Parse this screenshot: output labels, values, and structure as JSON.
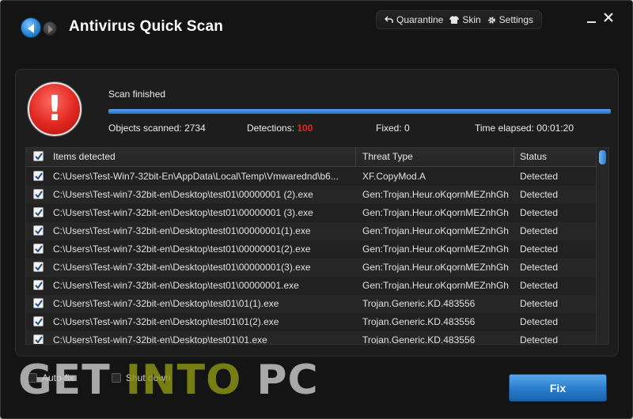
{
  "window": {
    "title": "Antivirus Quick Scan",
    "menu": [
      {
        "label": "Quarantine",
        "icon": "back-arrow-icon"
      },
      {
        "label": "Skin",
        "icon": "shirt-icon"
      },
      {
        "label": "Settings",
        "icon": "gear-icon"
      }
    ]
  },
  "scan": {
    "status": "Scan finished",
    "progress_percent": 100,
    "objects_label": "Objects scanned:",
    "objects_value": "2734",
    "detections_label": "Detections:",
    "detections_value": "100",
    "fixed_label": "Fixed:",
    "fixed_value": "0",
    "elapsed_label": "Time elapsed:",
    "elapsed_value": "00:01:20"
  },
  "table": {
    "headers": {
      "items": "Items detected",
      "threat": "Threat Type",
      "status": "Status"
    },
    "rows": [
      {
        "path": "C:\\Users\\Test-Win7-32bit-En\\AppData\\Local\\Temp\\Vmwarednd\\b6...",
        "threat": "XF.CopyMod.A",
        "status": "Detected"
      },
      {
        "path": "C:\\Users\\Test-win7-32bit-en\\Desktop\\test01\\00000001 (2).exe",
        "threat": "Gen:Trojan.Heur.oKqornMEZnhGh",
        "status": "Detected"
      },
      {
        "path": "C:\\Users\\Test-win7-32bit-en\\Desktop\\test01\\00000001 (3).exe",
        "threat": "Gen:Trojan.Heur.oKqornMEZnhGh",
        "status": "Detected"
      },
      {
        "path": "C:\\Users\\Test-win7-32bit-en\\Desktop\\test01\\00000001(1).exe",
        "threat": "Gen:Trojan.Heur.oKqornMEZnhGh",
        "status": "Detected"
      },
      {
        "path": "C:\\Users\\Test-win7-32bit-en\\Desktop\\test01\\00000001(2).exe",
        "threat": "Gen:Trojan.Heur.oKqornMEZnhGh",
        "status": "Detected"
      },
      {
        "path": "C:\\Users\\Test-win7-32bit-en\\Desktop\\test01\\00000001(3).exe",
        "threat": "Gen:Trojan.Heur.oKqornMEZnhGh",
        "status": "Detected"
      },
      {
        "path": "C:\\Users\\Test-win7-32bit-en\\Desktop\\test01\\00000001.exe",
        "threat": "Gen:Trojan.Heur.oKqornMEZnhGh",
        "status": "Detected"
      },
      {
        "path": "C:\\Users\\Test-win7-32bit-en\\Desktop\\test01\\01(1).exe",
        "threat": "Trojan.Generic.KD.483556",
        "status": "Detected"
      },
      {
        "path": "C:\\Users\\Test-win7-32bit-en\\Desktop\\test01\\01(2).exe",
        "threat": "Trojan.Generic.KD.483556",
        "status": "Detected"
      },
      {
        "path": "C:\\Users\\Test-win7-32bit-en\\Desktop\\test01\\01.exe",
        "threat": "Trojan.Generic.KD.483556",
        "status": "Detected"
      }
    ]
  },
  "footer": {
    "autofix_label": "Auto-fix",
    "shutdown_label": "Shut down",
    "fix_label": "Fix"
  },
  "watermark": {
    "part1": "GET ",
    "part2": "INTO",
    "part3": " PC"
  },
  "colors": {
    "accent": "#2c7fd0",
    "danger": "#e02620",
    "background": "#141414"
  }
}
